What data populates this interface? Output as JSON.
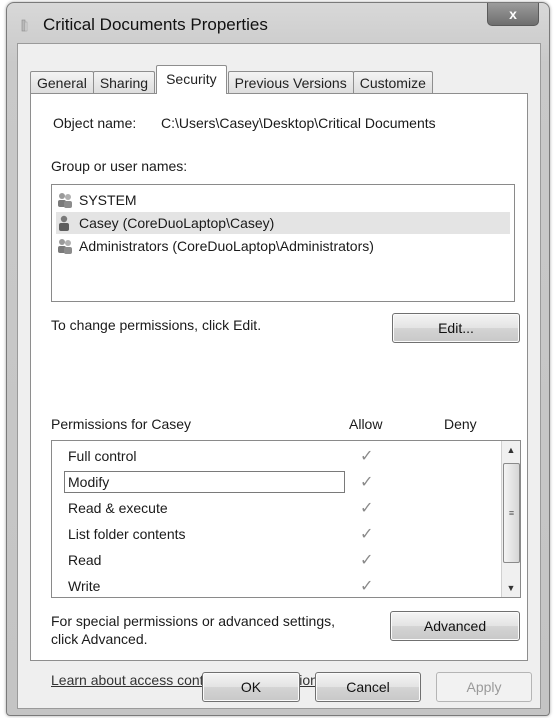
{
  "window": {
    "title": "Critical Documents Properties",
    "close_label": "x"
  },
  "tabs": [
    {
      "label": "General"
    },
    {
      "label": "Sharing"
    },
    {
      "label": "Security"
    },
    {
      "label": "Previous Versions"
    },
    {
      "label": "Customize"
    }
  ],
  "security": {
    "object_name_label": "Object name:",
    "object_name_value": "C:\\Users\\Casey\\Desktop\\Critical Documents",
    "group_label": "Group or user names:",
    "users": [
      {
        "name": "SYSTEM",
        "icon": "users-group-icon"
      },
      {
        "name": "Casey (CoreDuoLaptop\\Casey)",
        "icon": "user-icon"
      },
      {
        "name": "Administrators (CoreDuoLaptop\\Administrators)",
        "icon": "users-group-icon"
      }
    ],
    "change_text": "To change permissions, click Edit.",
    "edit_label": "Edit...",
    "permissions_for": "Permissions for Casey",
    "allow_header": "Allow",
    "deny_header": "Deny",
    "permissions": [
      {
        "name": "Full control",
        "allow": "✓"
      },
      {
        "name": "Modify",
        "allow": "✓"
      },
      {
        "name": "Read & execute",
        "allow": "✓"
      },
      {
        "name": "List folder contents",
        "allow": "✓"
      },
      {
        "name": "Read",
        "allow": "✓"
      },
      {
        "name": "Write",
        "allow": "✓"
      }
    ],
    "special_text_line1": "For special permissions or advanced settings,",
    "special_text_line2": "click Advanced.",
    "advanced_label": "Advanced",
    "learn_link": "Learn about access control and permissions"
  },
  "footer": {
    "ok_label": "OK",
    "cancel_label": "Cancel",
    "apply_label": "Apply"
  },
  "scrollbar": {
    "up": "▲",
    "down": "▼",
    "grip": "≡"
  }
}
